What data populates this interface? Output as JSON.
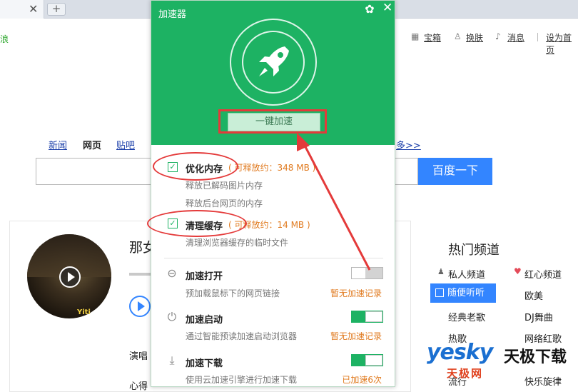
{
  "browser": {
    "new_tab_symbol": "+",
    "close_symbol": "✕"
  },
  "page": {
    "left_fragment": "浪",
    "top_links": [
      "宝箱",
      "换肤",
      "消息",
      "设为首页"
    ],
    "nav": [
      "新闻",
      "网页",
      "贴吧"
    ],
    "nav_more": "多>>",
    "search_button": "百度一下",
    "music": {
      "song_title_fragment": "那女",
      "singer_label": "演唱",
      "lyric_fragment": "心得",
      "avatar_text": "Yiti"
    },
    "hot_channels": {
      "title": "热门频道",
      "items": [
        "私人频道",
        "红心频道",
        "随便听听",
        "欧美",
        "经典老歌",
        "DJ舞曲",
        "热歌",
        "网络红歌",
        "流行",
        "快乐旋律"
      ]
    }
  },
  "popup": {
    "title": "加速器",
    "boost_button": "一键加速",
    "memory": {
      "title": "优化内存",
      "extra": "( 可释放约：348 MB )",
      "desc1": "释放已解码图片内存",
      "desc2": "释放后台网页的内存"
    },
    "cache": {
      "title": "清理缓存",
      "extra": "( 可释放约：14 MB )",
      "desc": "清理浏览器缓存的临时文件"
    },
    "rows": [
      {
        "title": "加速打开",
        "desc": "预加载鼠标下的网页链接",
        "status": "暂无加速记录",
        "enabled": false
      },
      {
        "title": "加速启动",
        "desc": "通过智能预读加速启动浏览器",
        "status": "暂无加速记录",
        "enabled": true
      },
      {
        "title": "加速下载",
        "desc": "使用云加速引擎进行加速下载",
        "status": "已加速6次",
        "enabled": true
      }
    ]
  },
  "watermark": {
    "brand": "yesky",
    "cn": "天极下载",
    "sub": "天极网"
  },
  "colors": {
    "accent_green": "#1db263",
    "annotation_red": "#e43a3a",
    "status_orange": "#e07a1f",
    "baidu_blue": "#3385ff"
  }
}
